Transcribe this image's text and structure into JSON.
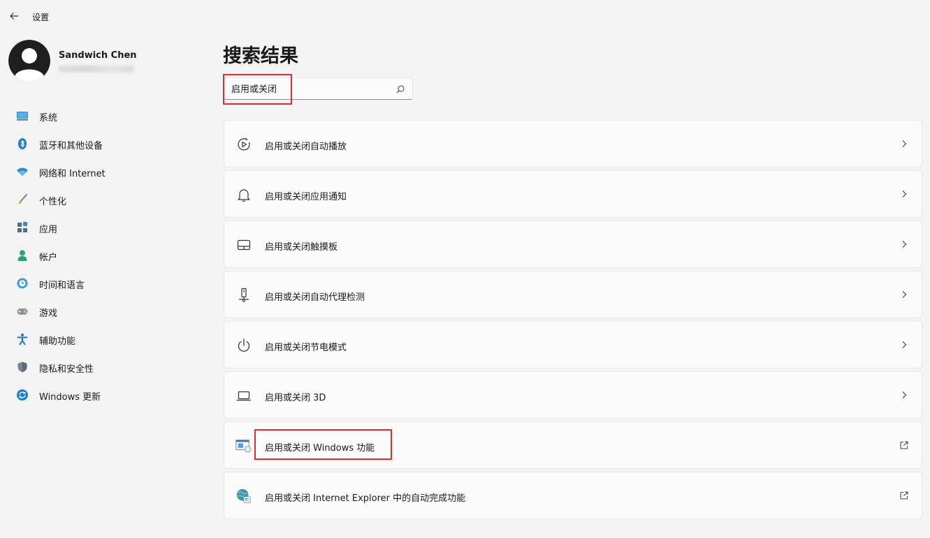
{
  "window": {
    "title": "设置"
  },
  "profile": {
    "name": "Sandwich Chen"
  },
  "sidebar": {
    "items": [
      {
        "label": "系统",
        "icon": "system-icon"
      },
      {
        "label": "蓝牙和其他设备",
        "icon": "bluetooth-icon"
      },
      {
        "label": "网络和 Internet",
        "icon": "wifi-icon"
      },
      {
        "label": "个性化",
        "icon": "brush-icon"
      },
      {
        "label": "应用",
        "icon": "apps-icon"
      },
      {
        "label": "帐户",
        "icon": "account-icon"
      },
      {
        "label": "时间和语言",
        "icon": "globe-clock-icon"
      },
      {
        "label": "游戏",
        "icon": "gamepad-icon"
      },
      {
        "label": "辅助功能",
        "icon": "accessibility-icon"
      },
      {
        "label": "隐私和安全性",
        "icon": "shield-icon"
      },
      {
        "label": "Windows 更新",
        "icon": "update-icon"
      }
    ]
  },
  "main": {
    "title": "搜索结果",
    "search": {
      "value": "启用或关闭"
    },
    "results": [
      {
        "label": "启用或关闭自动播放",
        "icon": "autoplay-icon",
        "action": "chevron-right-icon"
      },
      {
        "label": "启用或关闭应用通知",
        "icon": "bell-icon",
        "action": "chevron-right-icon"
      },
      {
        "label": "启用或关闭触摸板",
        "icon": "touchpad-icon",
        "action": "chevron-right-icon"
      },
      {
        "label": "启用或关闭自动代理检测",
        "icon": "proxy-icon",
        "action": "chevron-right-icon"
      },
      {
        "label": "启用或关闭节电模式",
        "icon": "power-icon",
        "action": "chevron-right-icon"
      },
      {
        "label": "启用或关闭 3D",
        "icon": "laptop-icon",
        "action": "chevron-right-icon"
      },
      {
        "label": "启用或关闭 Windows 功能",
        "icon": "windows-features-icon",
        "action": "external-link-icon"
      },
      {
        "label": "启用或关闭 Internet Explorer 中的自动完成功能",
        "icon": "internet-explorer-icon",
        "action": "external-link-icon"
      }
    ]
  },
  "colors": {
    "background": "#f3f3f3",
    "card": "#fbfbfb",
    "highlight": "#e32b2b",
    "accent": "#0067c0"
  }
}
